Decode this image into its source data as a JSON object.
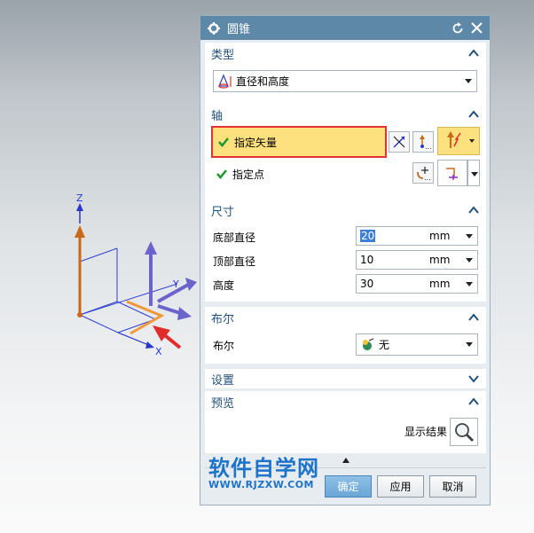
{
  "viewport": {
    "axes": {
      "z": "Z",
      "y": "Y",
      "x": "X"
    }
  },
  "dialog": {
    "title": "圆锥",
    "icons": {
      "settings": "gear-icon",
      "reset": "reset-icon",
      "close": "close-icon"
    },
    "type_section": {
      "title": "类型",
      "selected": "直径和高度"
    },
    "axis_section": {
      "title": "轴",
      "vector_label": "指定矢量",
      "point_label": "指定点"
    },
    "dimensions_section": {
      "title": "尺寸",
      "rows": [
        {
          "label": "底部直径",
          "value": "20",
          "unit": "mm"
        },
        {
          "label": "顶部直径",
          "value": "10",
          "unit": "mm"
        },
        {
          "label": "高度",
          "value": "30",
          "unit": "mm"
        }
      ]
    },
    "boolean_section": {
      "title": "布尔",
      "label": "布尔",
      "selected": "无"
    },
    "settings_section": {
      "title": "设置"
    },
    "preview_section": {
      "title": "预览",
      "show_result_label": "显示结果"
    },
    "buttons": {
      "ok": "确定",
      "apply": "应用",
      "cancel": "取消"
    }
  },
  "watermark": {
    "main": "软件自学网",
    "sub": "WWW.RJZXW.COM"
  },
  "colors": {
    "titlebar": "#5e88a7",
    "section_heading": "#214f7a",
    "highlight": "#fde17e",
    "highlight_border": "#e53333",
    "check": "#1f9a2a",
    "watermark": "#1d73c9"
  }
}
